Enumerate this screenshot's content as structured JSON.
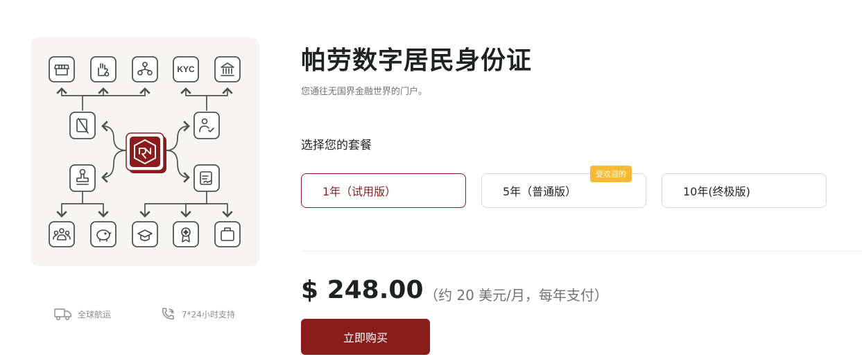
{
  "product": {
    "title": "帕劳数字居民身份证",
    "subtitle": "您通往无国界金融世界的门户。"
  },
  "hero": {
    "icons_top": [
      "store-icon",
      "hand-gear-icon",
      "network-icon",
      "kyc-icon",
      "bank-icon"
    ],
    "kyc_text": "KYC",
    "icons_left": [
      "id-slash-icon",
      "stamp-icon"
    ],
    "icons_right": [
      "user-check-icon",
      "document-sign-icon"
    ],
    "center": "rns-logo",
    "icons_bottom": [
      "group-icon",
      "piggy-bank-icon",
      "graduation-cap-icon",
      "award-icon",
      "briefcase-icon"
    ],
    "colors": {
      "line": "#4a5550",
      "accent": "#8b1c1c",
      "background": "#f6f5f1"
    }
  },
  "features": [
    {
      "icon": "truck-icon",
      "label": "全球航运"
    },
    {
      "icon": "phone-icon",
      "label": "7*24小时支持"
    }
  ],
  "plans": {
    "heading": "选择您的套餐",
    "options": [
      {
        "label": "1年（试用版）",
        "selected": true
      },
      {
        "label": "5年（普通版）",
        "selected": false,
        "badge": "受欢迎的"
      },
      {
        "label": "10年(终极版)",
        "selected": false
      }
    ]
  },
  "pricing": {
    "price": "$ 248.00",
    "note": "（约 20 美元/月，每年支付）",
    "buy_label": "立即购买"
  },
  "colors": {
    "brand": "#8b1c1c",
    "badge": "#f9b934",
    "text": "#1c2320",
    "muted": "#6f7572"
  }
}
